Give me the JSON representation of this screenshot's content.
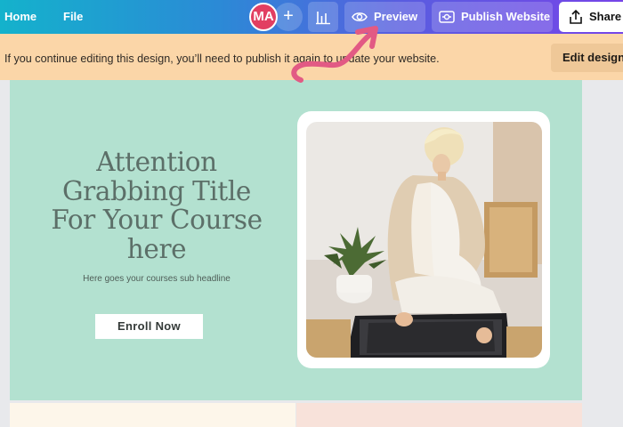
{
  "toolbar": {
    "home_label": "Home",
    "file_label": "File",
    "avatar_initials": "MA",
    "add_label": "+",
    "preview_label": "Preview",
    "publish_label": "Publish Website",
    "share_label": "Share"
  },
  "banner": {
    "message": "If you continue editing this design, you’ll need to publish it again to update your website.",
    "edit_label": "Edit design"
  },
  "hero": {
    "title": "Attention Grabbing Title For Your Course here",
    "subheadline": "Here goes your courses sub headline",
    "cta_label": "Enroll Now"
  },
  "colors": {
    "toolbar_start": "#14b2cc",
    "toolbar_end": "#7645e8",
    "banner_bg": "#fbd6a8",
    "hero_bg": "#b3e1d0",
    "avatar_bg": "#e23f62",
    "annotation_arrow": "#e25a84"
  }
}
